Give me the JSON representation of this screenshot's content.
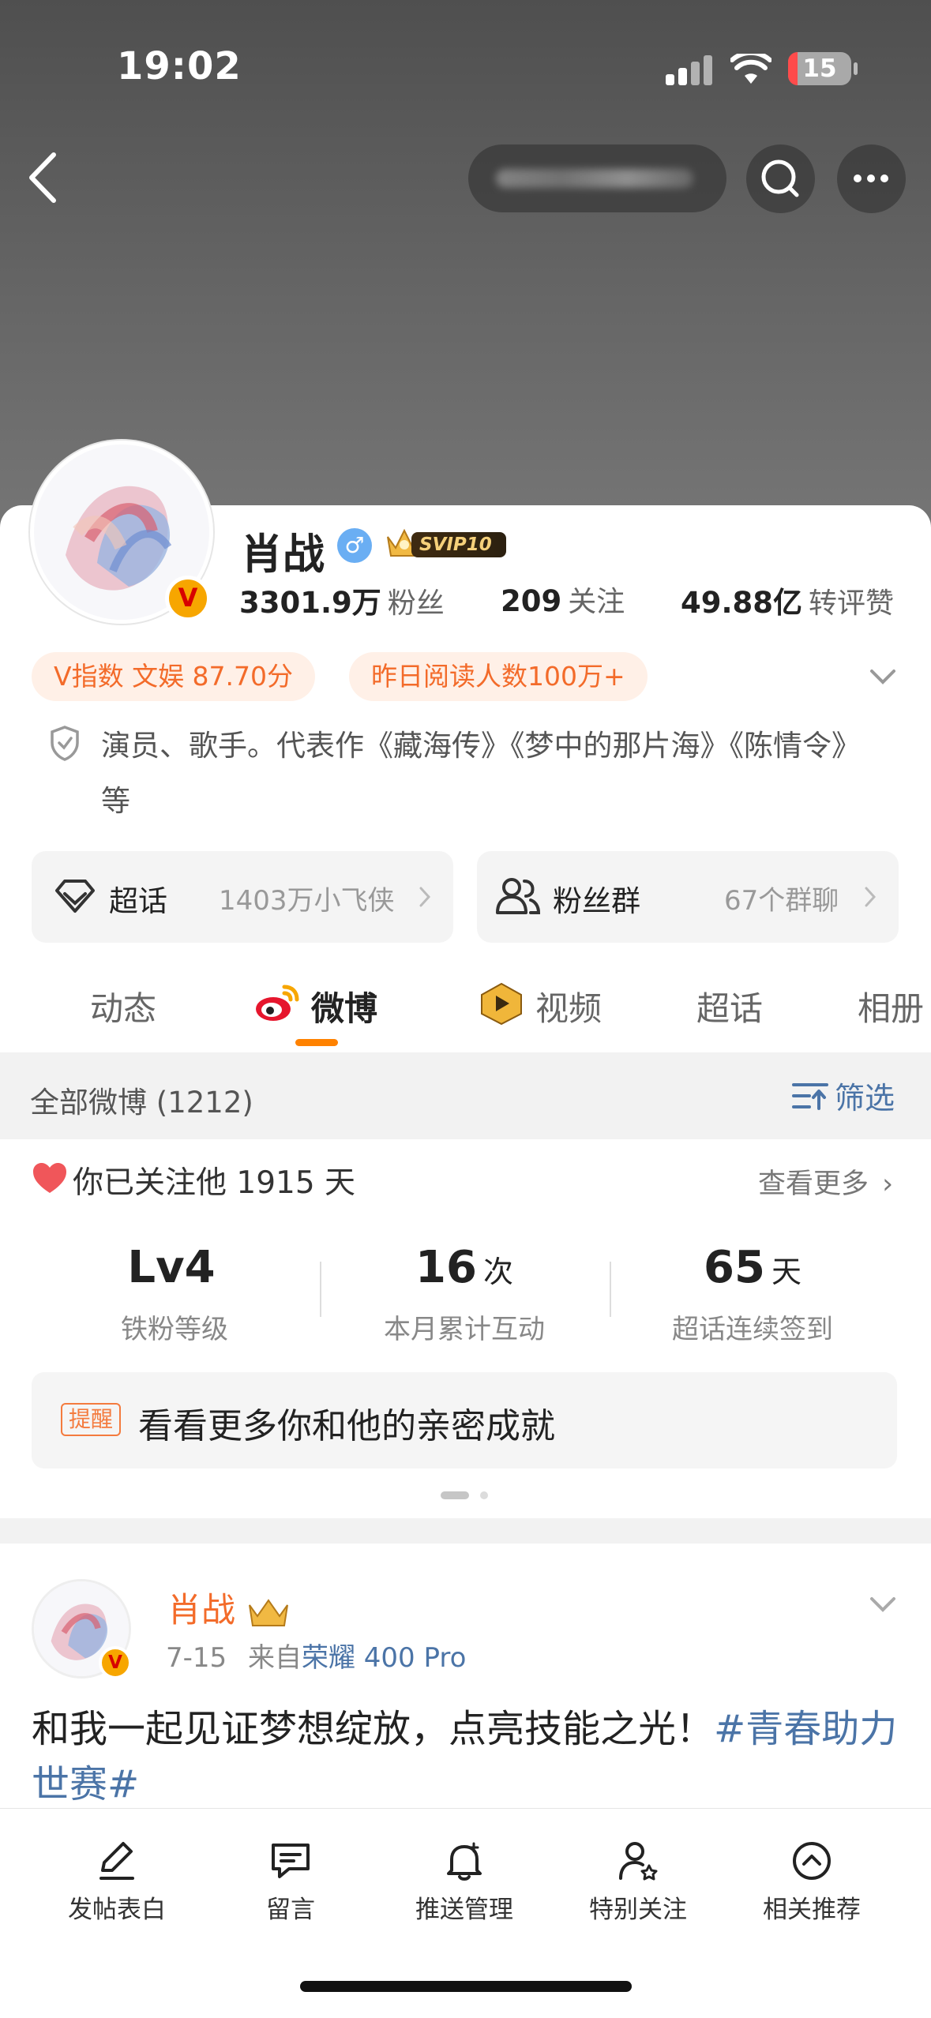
{
  "status_bar": {
    "time": "19:02",
    "battery": "15"
  },
  "header": {
    "search_placeholder_obscured": ""
  },
  "profile": {
    "name": "肖战",
    "gender_symbol": "♂",
    "vip_badge": "SVIP10",
    "stats": [
      {
        "value": "3301.9万",
        "label": "粉丝"
      },
      {
        "value": "209",
        "label": "关注"
      },
      {
        "value": "49.88亿",
        "label": "转评赞"
      }
    ],
    "tags": [
      "V指数 文娱 87.70分",
      "昨日阅读人数100万+"
    ],
    "bio": "演员、歌手。代表作《藏海传》《梦中的那片海》《陈情令》等"
  },
  "pills": [
    {
      "title": "超话",
      "sub": "1403万小飞侠"
    },
    {
      "title": "粉丝群",
      "sub": "67个群聊"
    }
  ],
  "tabs": [
    {
      "label": "动态"
    },
    {
      "label": "微博"
    },
    {
      "label": "视频"
    },
    {
      "label": "超话"
    },
    {
      "label": "相册"
    }
  ],
  "feed_bar": {
    "all_label": "全部微博 (1212)",
    "filter_label": "筛选"
  },
  "follow_card": {
    "title": "你已关注他 1915 天",
    "more": "查看更多",
    "metrics": [
      {
        "value": "Lv4",
        "unit": "",
        "label": "铁粉等级"
      },
      {
        "value": "16",
        "unit": "次",
        "label": "本月累计互动"
      },
      {
        "value": "65",
        "unit": "天",
        "label": "超话连续签到"
      }
    ],
    "tip_label": "提醒",
    "tip_text": "看看更多你和他的亲密成就"
  },
  "post": {
    "author": "肖战",
    "date": "7-15",
    "from_prefix": "来自",
    "device": "荣耀 400 Pro",
    "text": "和我一起见证梦想绽放，点亮技能之光！",
    "hashtag": "#青春助力世赛#"
  },
  "bottom_bar": [
    {
      "label": "发帖表白",
      "icon": "pen-icon"
    },
    {
      "label": "留言",
      "icon": "chat-icon"
    },
    {
      "label": "推送管理",
      "icon": "bell-icon"
    },
    {
      "label": "特别关注",
      "icon": "user-star-icon"
    },
    {
      "label": "相关推荐",
      "icon": "up-circle-icon"
    }
  ],
  "colors": {
    "accent": "#ff8200",
    "orange_text": "#f36b2a",
    "link": "#4b74a7"
  }
}
